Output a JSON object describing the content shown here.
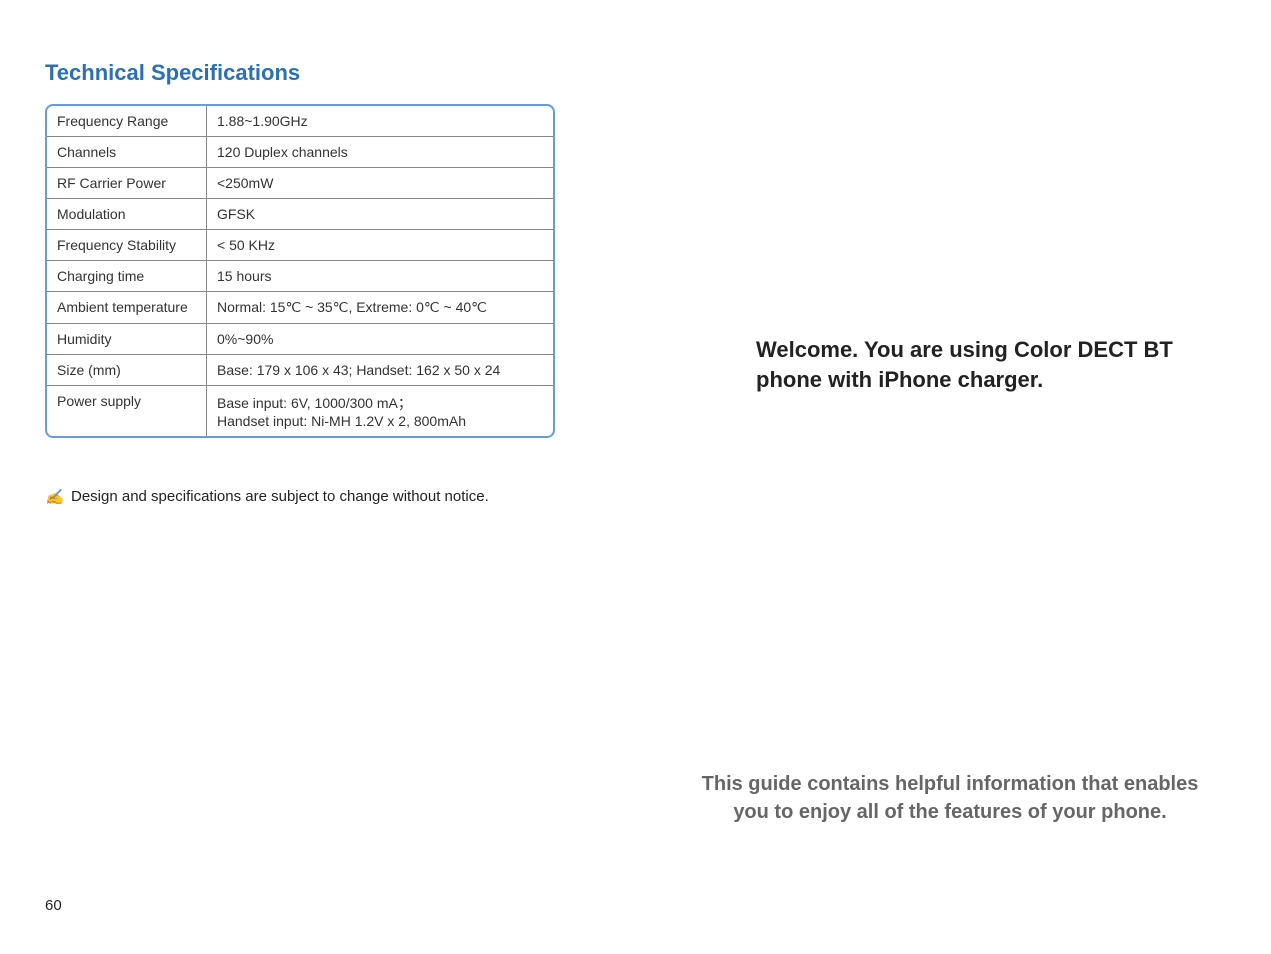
{
  "left": {
    "title": "Technical Specifications",
    "rows": [
      {
        "label": "Frequency Range",
        "value": "1.88~1.90GHz"
      },
      {
        "label": "Channels",
        "value": "120 Duplex channels"
      },
      {
        "label": "RF Carrier Power",
        "value": "<250mW"
      },
      {
        "label": "Modulation",
        "value": "GFSK"
      },
      {
        "label": "Frequency Stability",
        "value": "<    50 KHz"
      },
      {
        "label": "Charging time",
        "value": "15 hours"
      },
      {
        "label": "Ambient temperature",
        "value": "Normal: 15℃ ~ 35℃, Extreme: 0℃ ~ 40℃"
      },
      {
        "label": "Humidity",
        "value": "0%~90%"
      },
      {
        "label": "Size (mm)",
        "value": "Base: 179 x 106 x 43; Handset: 162 x 50 x 24"
      },
      {
        "label": "Power supply",
        "value": "Base input: 6V, 1000/300 mA；\nHandset input: Ni-MH 1.2V x 2, 800mAh"
      }
    ],
    "note_icon": "✍",
    "note_text": "Design and specifications are subject to change without notice."
  },
  "right": {
    "welcome": "Welcome. You are using Color DECT BT phone with iPhone charger.",
    "guide": "This guide contains helpful information that enables you to enjoy all of the features of your phone."
  },
  "page_number": "60"
}
